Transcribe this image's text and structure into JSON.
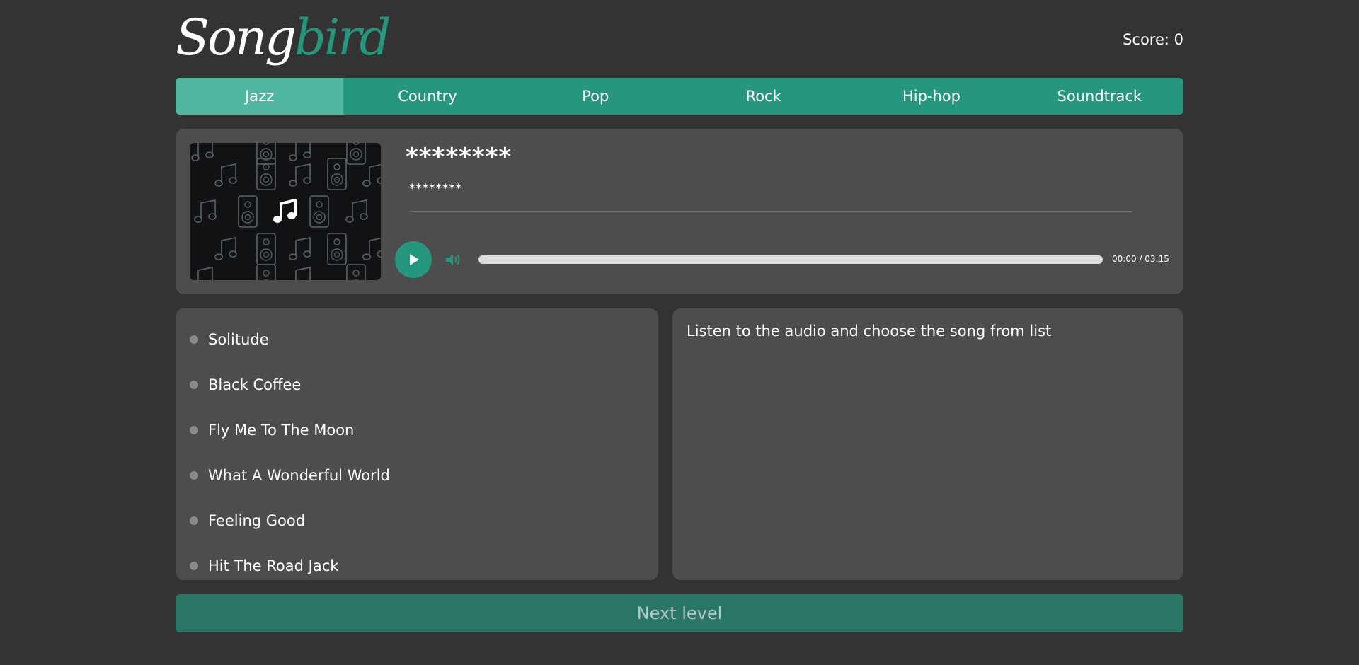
{
  "header": {
    "logo_part_a": "Song",
    "logo_part_b": "bird",
    "score_label": "Score: 0"
  },
  "genres": [
    {
      "label": "Jazz",
      "active": true
    },
    {
      "label": "Country",
      "active": false
    },
    {
      "label": "Pop",
      "active": false
    },
    {
      "label": "Rock",
      "active": false
    },
    {
      "label": "Hip-hop",
      "active": false
    },
    {
      "label": "Soundtrack",
      "active": false
    }
  ],
  "player": {
    "track_title": "********",
    "track_artist": "********",
    "cover_icon": "music-note-icon",
    "play_icon": "play-icon",
    "volume_icon": "volume-icon",
    "progress_fraction": 0,
    "time_label": "00:00 / 03:15"
  },
  "options": [
    {
      "label": "Solitude"
    },
    {
      "label": "Black Coffee"
    },
    {
      "label": "Fly Me To The Moon"
    },
    {
      "label": "What A Wonderful World"
    },
    {
      "label": "Feeling Good"
    },
    {
      "label": "Hit The Road Jack"
    }
  ],
  "info": {
    "text": "Listen to the audio and choose the song from list"
  },
  "next_button": {
    "label": "Next level"
  },
  "colors": {
    "background": "#333333",
    "panel": "#4d4d4d",
    "accent": "#26977f",
    "accent_active": "#50b7a1",
    "next_button": "#2a7767"
  }
}
